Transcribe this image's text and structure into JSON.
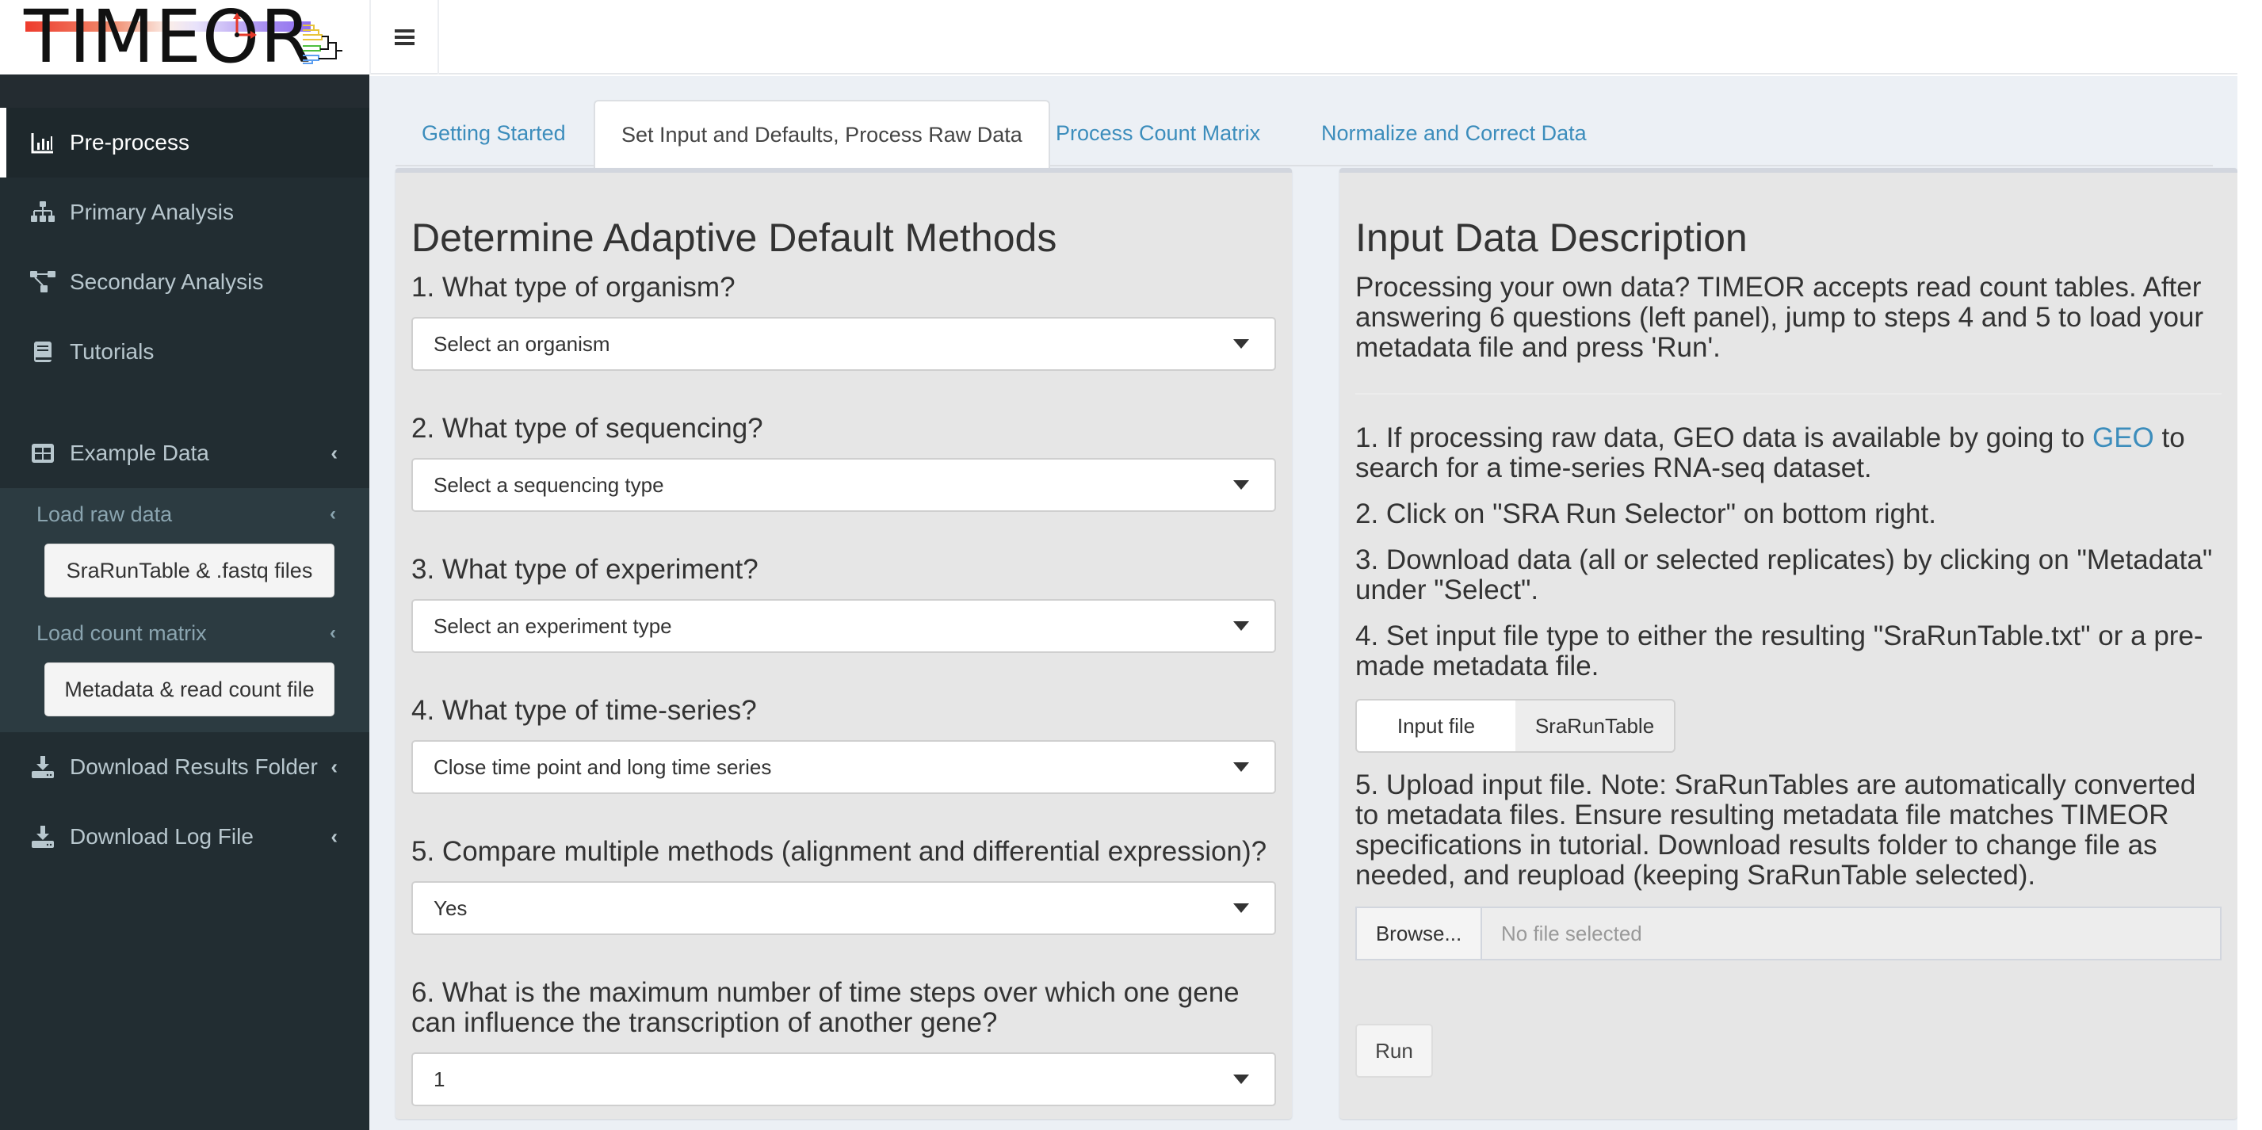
{
  "header": {
    "logo_text": "TIMEOR",
    "toggle_icon": "hamburger-menu-icon"
  },
  "sidebar": {
    "items": [
      {
        "label": "Pre-process",
        "icon": "bar-chart-icon",
        "active": true
      },
      {
        "label": "Primary Analysis",
        "icon": "sitemap-icon"
      },
      {
        "label": "Secondary Analysis",
        "icon": "project-diagram-icon"
      },
      {
        "label": "Tutorials",
        "icon": "book-icon"
      },
      {
        "label": "Example Data",
        "icon": "table-icon",
        "chevron": "chevron-left-icon"
      },
      {
        "label": "Download Results Folder",
        "icon": "download-icon",
        "chevron": "chevron-left-icon"
      },
      {
        "label": "Download Log File",
        "icon": "download-icon",
        "chevron": "chevron-left-icon"
      }
    ],
    "example_data": {
      "load_raw": {
        "label": "Load raw data",
        "button": "SraRunTable & .fastq files"
      },
      "load_count": {
        "label": "Load count matrix",
        "button": "Metadata & read count file"
      }
    }
  },
  "tabs": [
    {
      "label": "Getting Started"
    },
    {
      "label": "Set Input and Defaults, Process Raw Data",
      "active": true
    },
    {
      "label": "Process Count Matrix"
    },
    {
      "label": "Normalize and Correct Data"
    }
  ],
  "left_panel": {
    "title": "Determine Adaptive Default Methods",
    "questions": [
      {
        "label": "1. What type of organism?",
        "value": "Select an organism"
      },
      {
        "label": "2. What type of sequencing?",
        "value": "Select a sequencing type"
      },
      {
        "label": "3. What type of experiment?",
        "value": "Select an experiment type"
      },
      {
        "label": "4. What type of time-series?",
        "value": "Close time point and long time series"
      },
      {
        "label": "5. Compare multiple methods (alignment and differential expression)?",
        "value": "Yes"
      },
      {
        "label": "6. What is the maximum number of time steps over which one gene can influence the transcription of another gene?",
        "value": "1"
      }
    ]
  },
  "right_panel": {
    "title": "Input Data Description",
    "intro": "Processing your own data? TIMEOR accepts read count tables. After answering 6 questions (left panel), jump to steps 4 and 5 to load your metadata file and press 'Run'.",
    "step1_pre": "1. If processing raw data, GEO data is available by going to ",
    "step1_link": "GEO",
    "step1_post": " to search for a time-series RNA-seq dataset.",
    "step2": "2. Click on \"SRA Run Selector\" on bottom right.",
    "step3": "3. Download data (all or selected replicates) by clicking on \"Metadata\" under \"Select\".",
    "step4": "4. Set input file type to either the resulting \"SraRunTable.txt\" or a pre-made metadata file.",
    "file_type_options": [
      "Input file",
      "SraRunTable"
    ],
    "file_type_selected": "SraRunTable",
    "step5": "5. Upload input file. Note: SraRunTables are automatically converted to metadata files. Ensure resulting metadata file matches TIMEOR specifications in tutorial. Download results folder to change file as needed, and reupload (keeping SraRunTable selected).",
    "browse_label": "Browse...",
    "file_placeholder": "No file selected",
    "run_label": "Run"
  },
  "colors": {
    "sidebar_bg": "#222d32",
    "content_bg": "#ecf0f5",
    "link": "#3c8dbc",
    "box_bg": "#e6e6e6"
  }
}
